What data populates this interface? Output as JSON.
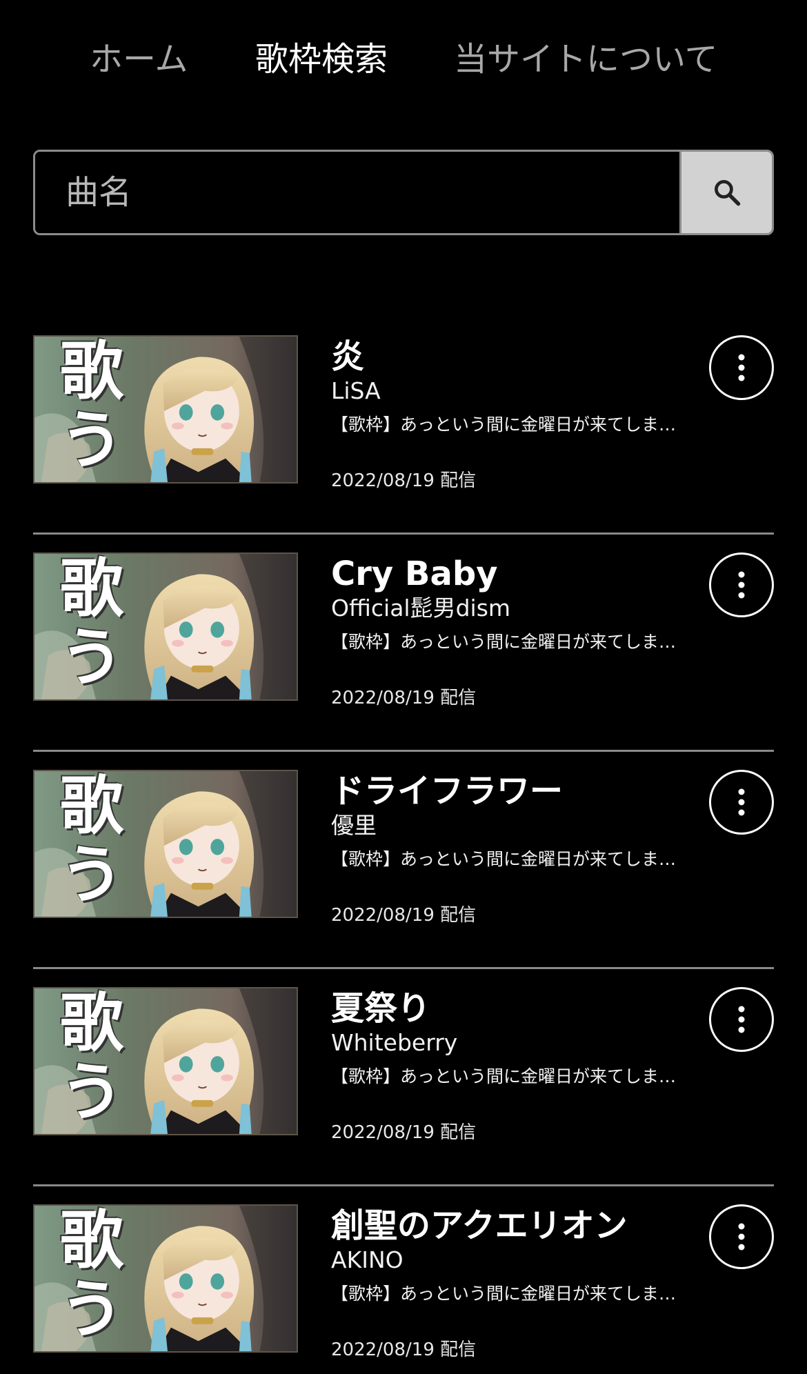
{
  "nav": {
    "home": "ホーム",
    "search": "歌枠検索",
    "about": "当サイトについて"
  },
  "search": {
    "placeholder": "曲名",
    "icon": "search-icon"
  },
  "thumbnail_text": "歌う",
  "songs": [
    {
      "title": "炎",
      "artist": "LiSA",
      "stream": "【歌枠】あっという間に金曜日が来てしま…",
      "date": "2022/08/19 配信"
    },
    {
      "title": "Cry Baby",
      "artist": "Official髭男dism",
      "stream": "【歌枠】あっという間に金曜日が来てしま…",
      "date": "2022/08/19 配信"
    },
    {
      "title": "ドライフラワー",
      "artist": "優里",
      "stream": "【歌枠】あっという間に金曜日が来てしま…",
      "date": "2022/08/19 配信"
    },
    {
      "title": "夏祭り",
      "artist": "Whiteberry",
      "stream": "【歌枠】あっという間に金曜日が来てしま…",
      "date": "2022/08/19 配信"
    },
    {
      "title": "創聖のアクエリオン",
      "artist": "AKINO",
      "stream": "【歌枠】あっという間に金曜日が来てしま…",
      "date": "2022/08/19 配信"
    }
  ],
  "colors": {
    "background": "#000000",
    "nav_inactive": "#a8a8a8",
    "search_button": "#d2d2d2",
    "divider": "#8a8a8a"
  }
}
